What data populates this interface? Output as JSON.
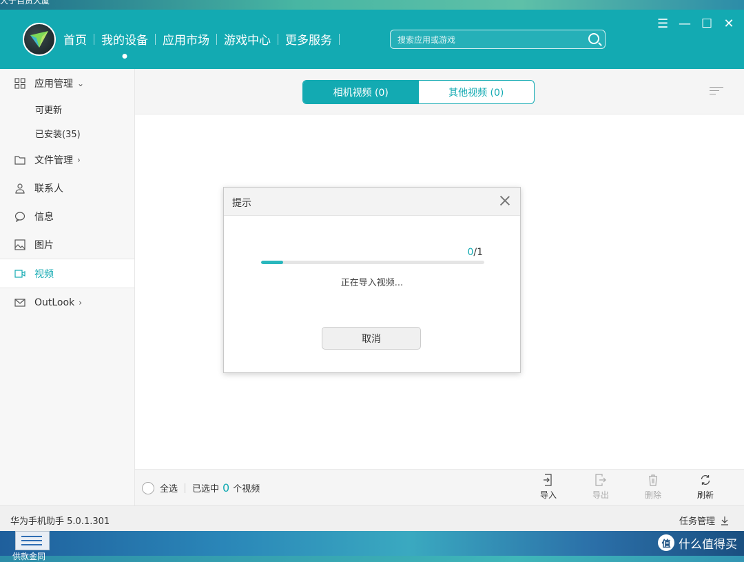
{
  "desktop": {
    "top_text": "大于自贸大厦",
    "file_label": "供款金同",
    "watermark": "什么值得买",
    "watermark_badge": "值"
  },
  "app": {
    "nav": [
      {
        "label": "首页",
        "active": false
      },
      {
        "label": "我的设备",
        "active": true
      },
      {
        "label": "应用市场",
        "active": false
      },
      {
        "label": "游戏中心",
        "active": false
      },
      {
        "label": "更多服务",
        "active": false
      }
    ],
    "search": {
      "placeholder": "搜索应用或游戏"
    },
    "window_controls": [
      "menu-icon",
      "minimize-icon",
      "maximize-icon",
      "close-icon"
    ]
  },
  "sidebar": {
    "app_manage": "应用管理",
    "updatable": "可更新",
    "installed": "已安装(35)",
    "file_manage": "文件管理",
    "contacts": "联系人",
    "messages": "信息",
    "pictures": "图片",
    "video": "视频",
    "outlook": "OutLook"
  },
  "tabs": {
    "camera": "相机视频 (0)",
    "other": "其他视频 (0)"
  },
  "bottom": {
    "select_all": "全选",
    "selected_prefix": "已选中",
    "selected_count": "0",
    "selected_suffix": "个视频",
    "import": "导入",
    "export": "导出",
    "delete": "删除",
    "refresh": "刷新"
  },
  "status": {
    "version": "华为手机助手 5.0.1.301",
    "task_manager": "任务管理"
  },
  "dialog": {
    "title": "提示",
    "current": "0",
    "total": "/1",
    "progress": 0.1,
    "message": "正在导入视频...",
    "cancel": "取消"
  },
  "colors": {
    "accent": "#13aab2"
  }
}
